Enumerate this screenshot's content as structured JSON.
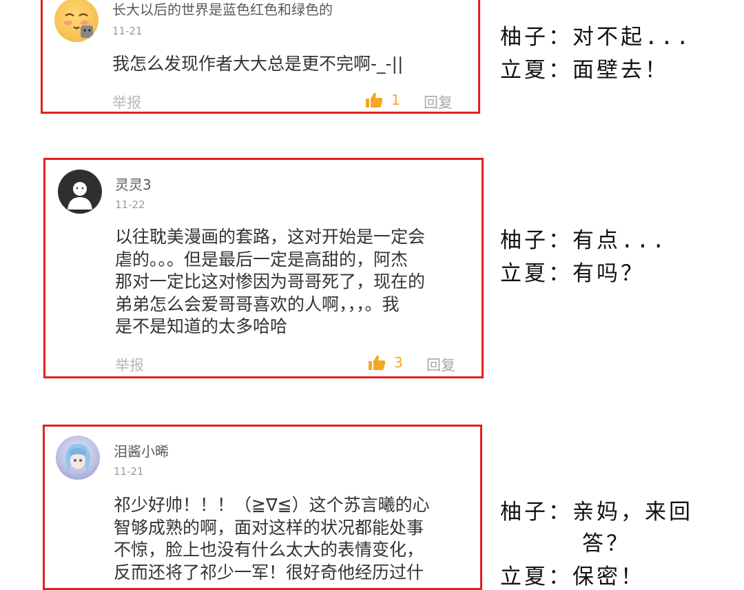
{
  "comments": [
    {
      "username": "长大以后的世界是蓝色红色和绿色的",
      "date": "11-21",
      "text": "我怎么发现作者大大总是更不完啊-_-||",
      "report_label": "举报",
      "likes": "1",
      "reply_label": "回复",
      "avatar_icon": "emoji-face-avatar"
    },
    {
      "username": "灵灵3",
      "date": "11-22",
      "text": "以往耽美漫画的套路，这对开始是一定会\n虐的。。。但是最后一定是高甜的，阿杰\n那对一定比这对惨因为哥哥死了，现在的\n弟弟怎么会爱哥哥喜欢的人啊，，，。我\n是不是知道的太多哈哈",
      "report_label": "举报",
      "likes": "3",
      "reply_label": "回复",
      "avatar_icon": "default-avatar"
    },
    {
      "username": "泪酱小晞",
      "date": "11-21",
      "text": "祁少好帅！！！（≧∇≦）这个苏言曦的心\n智够成熟的啊，面对这样的状况都能处事\n不惊，脸上也没有什么太大的表情变化，\n反而还将了祁少一军！很好奇他经历过什",
      "avatar_icon": "anime-girl-avatar"
    }
  ],
  "replies": [
    {
      "line1": "柚子：对不起...",
      "line2": "立夏：面壁去！"
    },
    {
      "line1": "柚子：有点...",
      "line2": "立夏：有吗？"
    },
    {
      "line1": "柚子：亲妈，来回",
      "line1b": "答？",
      "line2": "立夏：保密！"
    }
  ],
  "colors": {
    "accent_border": "#e02020",
    "like": "#f4a624"
  }
}
